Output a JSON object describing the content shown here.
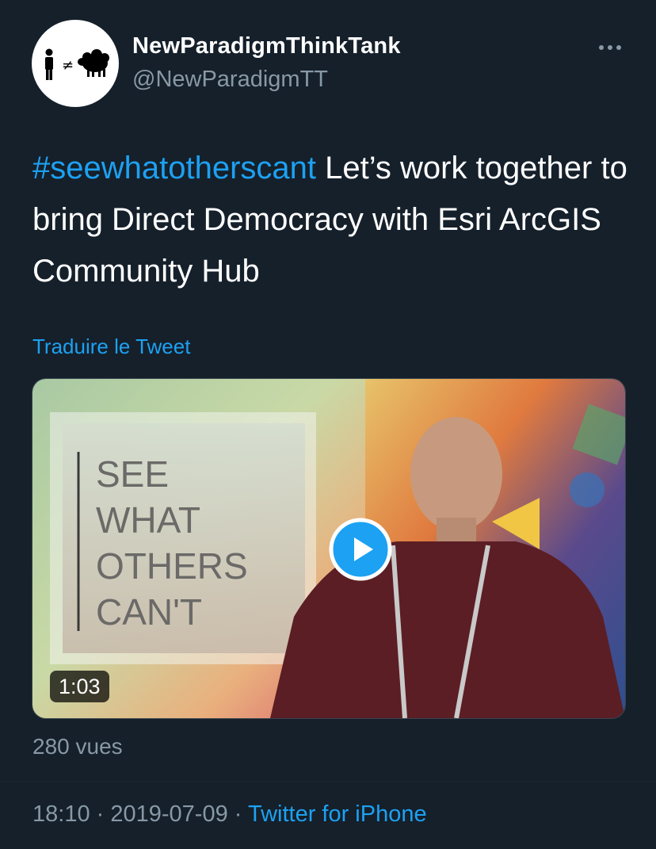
{
  "author": {
    "avatar_icon": "person-not-equal-sheep-icon",
    "avatar_symbol": "≠",
    "name": "NewParadigmThinkTank",
    "handle": "@NewParadigmTT"
  },
  "more_icon": "more-horizontal-icon",
  "tweet": {
    "hashtag": "#seewhatotherscant",
    "text": " Let’s work together to bring Direct Democracy with Esri ArcGIS Community Hub",
    "translate_label": "Traduire le Tweet"
  },
  "video": {
    "sign_lines": [
      "SEE",
      "WHAT",
      "OTHERS",
      "CAN'T"
    ],
    "duration": "1:03",
    "play_icon": "play-icon"
  },
  "stats": {
    "views": "280 vues"
  },
  "meta": {
    "time": "18:10",
    "separator": " · ",
    "date": "2019-07-09",
    "source": "Twitter for iPhone"
  },
  "colors": {
    "background": "#15202b",
    "accent": "#1da1f2",
    "secondary_text": "#8899a6"
  }
}
